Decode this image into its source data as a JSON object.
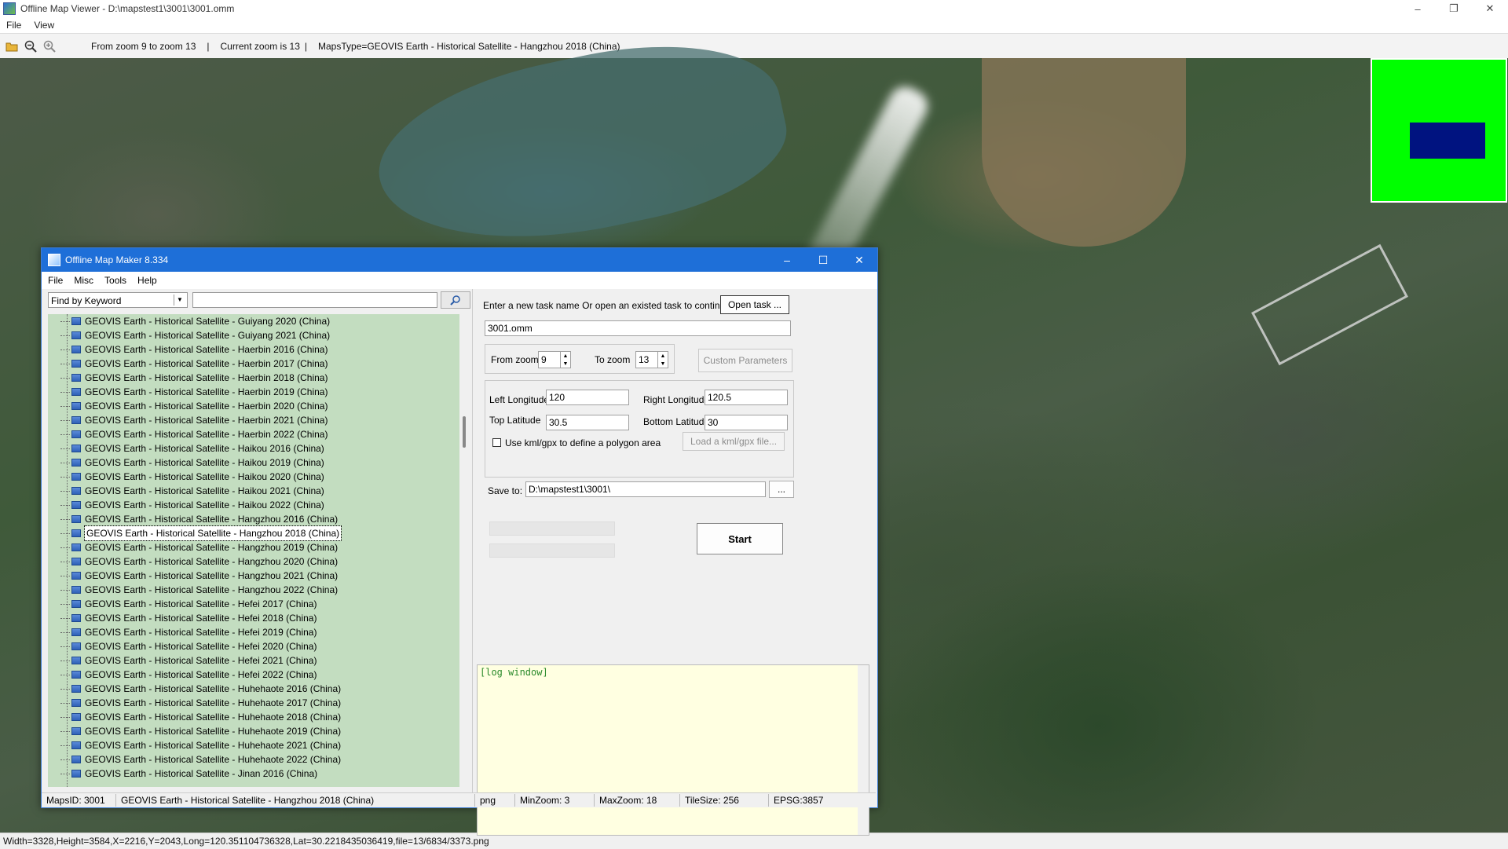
{
  "app": {
    "title": "Offline Map Viewer - D:\\mapstest1\\3001\\3001.omm",
    "menu": [
      "File",
      "View"
    ],
    "window_controls": [
      "–",
      "❐",
      "✕"
    ]
  },
  "toolbar": {
    "zoom_range": "From zoom 9 to zoom 13",
    "current_zoom": "Current zoom is 13",
    "maps_type": "MapsType=GEOVIS Earth - Historical Satellite - Hangzhou 2018 (China)",
    "separator": "|",
    "icons": [
      "open-folder-icon",
      "zoom-out-icon",
      "zoom-in-icon"
    ]
  },
  "statusbar": {
    "text": "Width=3328,Height=3584,X=2216,Y=2043,Long=120.351104736328,Lat=30.2218435036419,file=13/6834/3373.png"
  },
  "dialog": {
    "title": "Offline Map Maker 8.334",
    "menu": [
      "File",
      "Misc",
      "Tools",
      "Help"
    ],
    "find_mode": "Find by Keyword",
    "find_value": "",
    "tree_items": [
      "GEOVIS Earth - Historical Satellite - Guiyang 2020 (China)",
      "GEOVIS Earth - Historical Satellite - Guiyang 2021 (China)",
      "GEOVIS Earth - Historical Satellite - Haerbin 2016 (China)",
      "GEOVIS Earth - Historical Satellite - Haerbin 2017 (China)",
      "GEOVIS Earth - Historical Satellite - Haerbin 2018 (China)",
      "GEOVIS Earth - Historical Satellite - Haerbin 2019 (China)",
      "GEOVIS Earth - Historical Satellite - Haerbin 2020 (China)",
      "GEOVIS Earth - Historical Satellite - Haerbin 2021 (China)",
      "GEOVIS Earth - Historical Satellite - Haerbin 2022 (China)",
      "GEOVIS Earth - Historical Satellite - Haikou 2016 (China)",
      "GEOVIS Earth - Historical Satellite - Haikou 2019 (China)",
      "GEOVIS Earth - Historical Satellite - Haikou 2020 (China)",
      "GEOVIS Earth - Historical Satellite - Haikou 2021 (China)",
      "GEOVIS Earth - Historical Satellite - Haikou 2022 (China)",
      "GEOVIS Earth - Historical Satellite - Hangzhou 2016 (China)",
      "GEOVIS Earth - Historical Satellite - Hangzhou 2018 (China)",
      "GEOVIS Earth - Historical Satellite - Hangzhou 2019 (China)",
      "GEOVIS Earth - Historical Satellite - Hangzhou 2020 (China)",
      "GEOVIS Earth - Historical Satellite - Hangzhou 2021 (China)",
      "GEOVIS Earth - Historical Satellite - Hangzhou 2022 (China)",
      "GEOVIS Earth - Historical Satellite - Hefei 2017 (China)",
      "GEOVIS Earth - Historical Satellite - Hefei 2018 (China)",
      "GEOVIS Earth - Historical Satellite - Hefei 2019 (China)",
      "GEOVIS Earth - Historical Satellite - Hefei 2020 (China)",
      "GEOVIS Earth - Historical Satellite - Hefei 2021 (China)",
      "GEOVIS Earth - Historical Satellite - Hefei 2022 (China)",
      "GEOVIS Earth - Historical Satellite - Huhehaote 2016 (China)",
      "GEOVIS Earth - Historical Satellite - Huhehaote 2017 (China)",
      "GEOVIS Earth - Historical Satellite - Huhehaote 2018 (China)",
      "GEOVIS Earth - Historical Satellite - Huhehaote 2019 (China)",
      "GEOVIS Earth - Historical Satellite - Huhehaote 2021 (China)",
      "GEOVIS Earth - Historical Satellite - Huhehaote 2022 (China)",
      "GEOVIS Earth - Historical Satellite - Jinan 2016 (China)"
    ],
    "selected_item": "GEOVIS Earth - Historical Satellite - Hangzhou 2018 (China)",
    "task_prompt": "Enter a new task name Or open an existed task to continue:",
    "open_task_label": "Open task ...",
    "task_name": "3001.omm",
    "from_zoom_label": "From zoom",
    "from_zoom": "9",
    "to_zoom_label": "To zoom",
    "to_zoom": "13",
    "custom_params_label": "Custom Parameters",
    "left_long_label": "Left Longitude",
    "left_long": "120",
    "right_long_label": "Right Longitude",
    "right_long": "120.5",
    "top_lat_label": "Top Latitude",
    "top_lat": "30.5",
    "bottom_lat_label": "Bottom Latitude",
    "bottom_lat": "30",
    "kml_label": "Use kml/gpx to define a polygon area",
    "load_kml_label": "Load a kml/gpx file...",
    "save_to_label": "Save to:",
    "save_to": "D:\\mapstest1\\3001\\",
    "browse_label": "...",
    "start_label": "Start",
    "log_text": "[log window]",
    "status": {
      "maps_id": "MapsID: 3001",
      "maps_name": "GEOVIS Earth - Historical Satellite - Hangzhou 2018 (China)",
      "format": "png",
      "min_zoom": "MinZoom: 3",
      "max_zoom": "MaxZoom: 18",
      "tile_size": "TileSize: 256",
      "epsg": "EPSG:3857"
    }
  },
  "colors": {
    "minimap_bg": "#00ff00",
    "minimap_view": "#001380",
    "tree_bg": "#c3ddc0",
    "dialog_title": "#1e6fd8",
    "log_bg": "#ffffe1"
  }
}
